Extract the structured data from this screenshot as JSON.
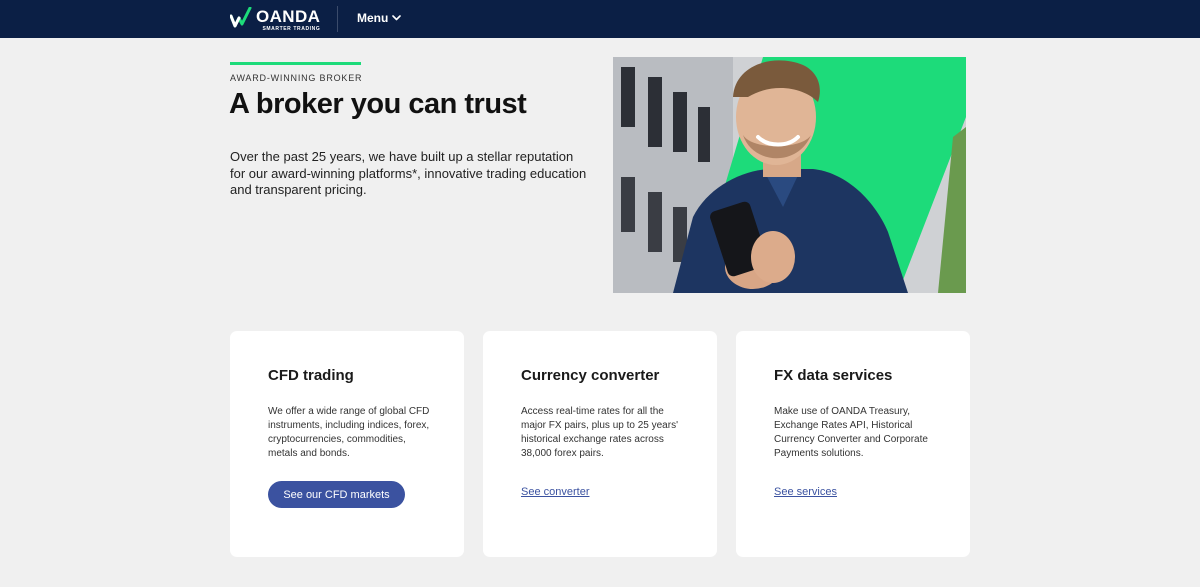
{
  "nav": {
    "logo_word": "OANDA",
    "logo_tagline": "SMARTER TRADING",
    "menu_label": "Menu"
  },
  "hero": {
    "eyebrow": "AWARD-WINNING BROKER",
    "title": "A broker you can trust",
    "description": "Over the past 25 years, we have built up a stellar reputation for our award-winning platforms*, innovative trading education and transparent pricing."
  },
  "cards": [
    {
      "title": "CFD trading",
      "body": "We offer a wide range of global CFD instruments, including indices, forex, cryptocurrencies, commodities, metals and bonds.",
      "action": "See our CFD markets"
    },
    {
      "title": "Currency converter",
      "body": "Access real-time rates for all the major FX pairs, plus up to 25 years' historical exchange rates across 38,000 forex pairs.",
      "action": "See converter"
    },
    {
      "title": "FX data services",
      "body": "Make use of OANDA Treasury, Exchange Rates API, Historical Currency Converter and Corporate Payments solutions.",
      "action": "See services"
    }
  ],
  "colors": {
    "nav_background": "#0b1f45",
    "accent_green": "#1ddb7a",
    "button_blue": "#3b52a0",
    "page_background": "#f0f0f0",
    "card_background": "#ffffff"
  }
}
